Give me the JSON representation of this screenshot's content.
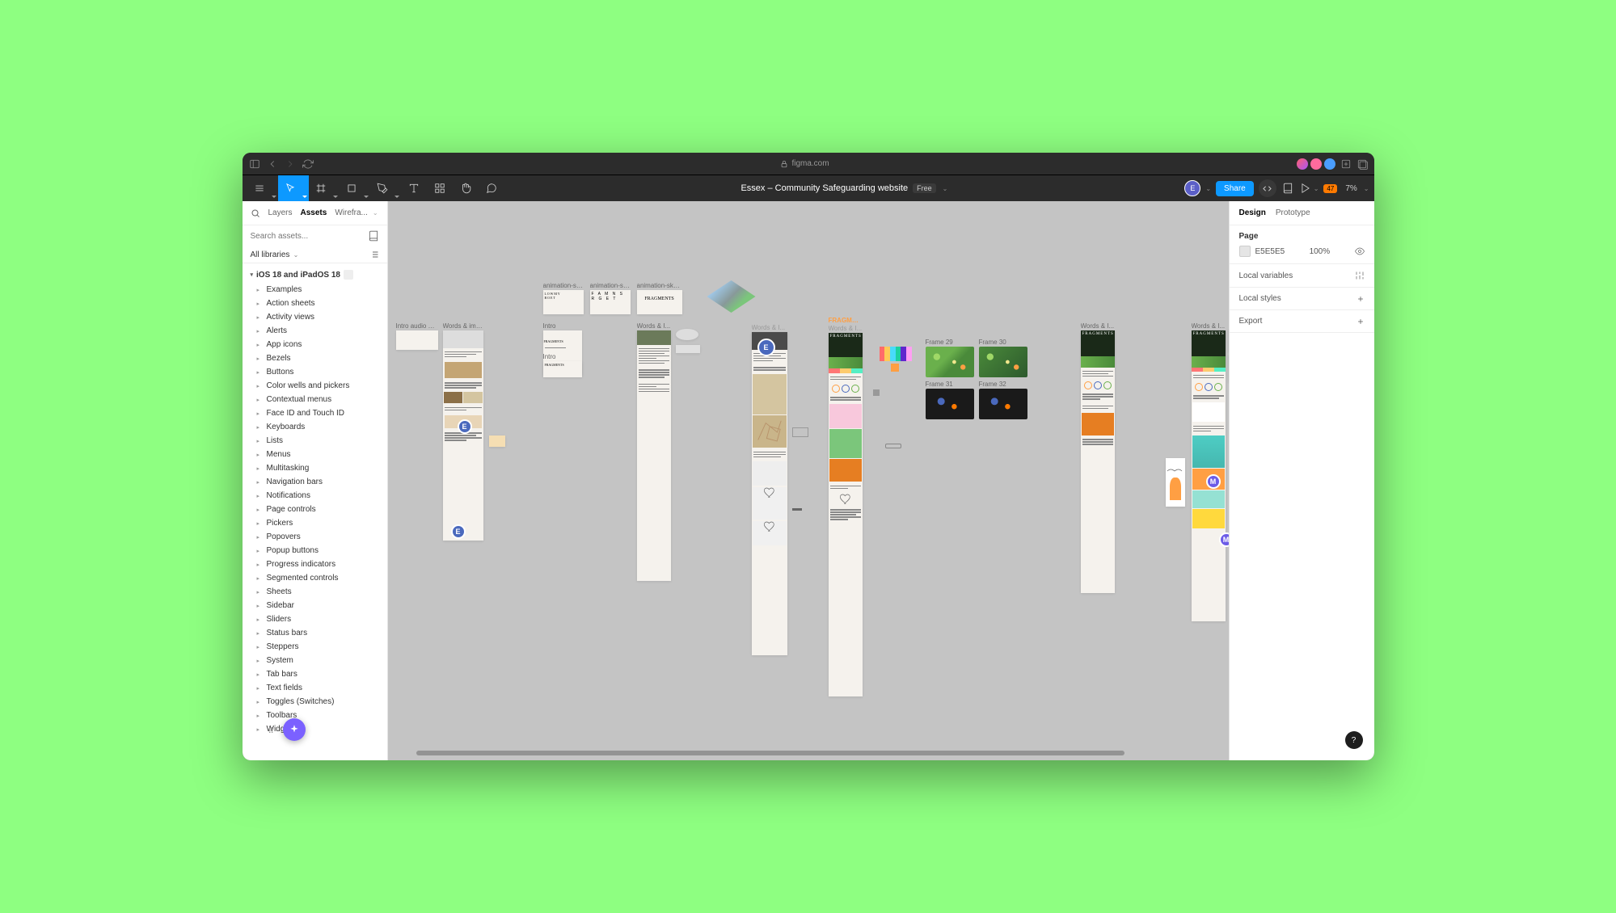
{
  "browser": {
    "url": "figma.com"
  },
  "toolbar": {
    "document_title": "Essex – Community Safeguarding website",
    "plan_badge": "Free",
    "share_label": "Share",
    "notif_count": "47",
    "zoom": "7%",
    "user_initial": "E"
  },
  "left_panel": {
    "tab_layers": "Layers",
    "tab_assets": "Assets",
    "page_name": "Wirefra...",
    "search_placeholder": "Search assets...",
    "library_filter": "All libraries",
    "library_name": "iOS 18 and iPadOS 18",
    "assets": [
      "Examples",
      "Action sheets",
      "Activity views",
      "Alerts",
      "App icons",
      "Bezels",
      "Buttons",
      "Color wells and pickers",
      "Contextual menus",
      "Face ID and Touch ID",
      "Keyboards",
      "Lists",
      "Menus",
      "Multitasking",
      "Navigation bars",
      "Notifications",
      "Page controls",
      "Pickers",
      "Popovers",
      "Popup buttons",
      "Progress indicators",
      "Segmented controls",
      "Sheets",
      "Sidebar",
      "Sliders",
      "Status bars",
      "Steppers",
      "System",
      "Tab bars",
      "Text fields",
      "Toggles (Switches)",
      "Toolbars",
      "Widgets"
    ]
  },
  "canvas": {
    "frames": {
      "intro_audio": "Intro audio & v...",
      "words_images_1": "Words & imag...",
      "anim1": "animation-ske...",
      "anim2": "animation-ske...",
      "anim3": "animation-ske...",
      "intro": "Intro",
      "words_i_2": "Words & I...",
      "words_i_3": "Words & I...",
      "fragments_title": "FRAGMENTS",
      "frame29": "Frame 29",
      "frame30": "Frame 30",
      "frame31": "Frame 31",
      "frame32": "Frame 32",
      "words_i_4": "Words & I...",
      "words_i_5": "Words & I...",
      "intro_2": "Intro",
      "famns": "F A M N S",
      "rget": "R  G  E  T",
      "fragments_serif": "FRAGMENTS"
    },
    "cursors": {
      "e": "E",
      "m": "M"
    }
  },
  "right_panel": {
    "tab_design": "Design",
    "tab_prototype": "Prototype",
    "page_section": "Page",
    "page_color": "E5E5E5",
    "page_opacity": "100%",
    "local_variables": "Local variables",
    "local_styles": "Local styles",
    "export": "Export"
  },
  "help": "?"
}
